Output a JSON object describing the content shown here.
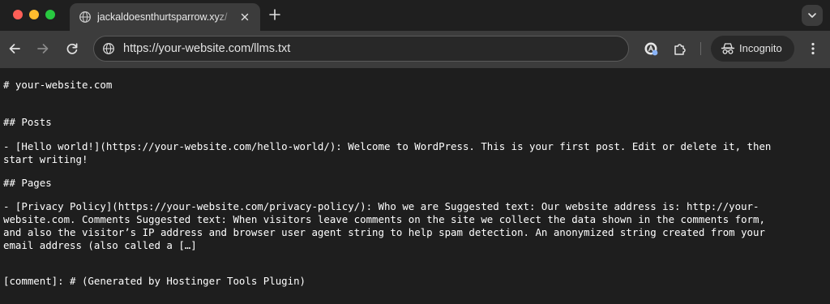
{
  "browser": {
    "tab": {
      "title": "jackaldoesnthurtsparrow.xyz/"
    },
    "address_bar": {
      "url": "https://your-website.com/llms.txt"
    },
    "incognito_label": "Incognito",
    "icons": {
      "favicon": "globe-icon",
      "tab_close": "close-icon",
      "new_tab": "plus-icon",
      "tab_search": "chevron-down-icon",
      "back": "arrow-left-icon",
      "forward": "arrow-right-icon",
      "reload": "reload-icon",
      "site_info": "site-info-icon",
      "extension_1": "extension-badge-icon",
      "extension_2": "puzzle-icon",
      "incognito": "incognito-icon",
      "menu": "kebab-menu-icon"
    },
    "colors": {
      "traffic_close": "#fe5f57",
      "traffic_minimize": "#febc2e",
      "traffic_maximize": "#28c840",
      "toolbar": "#3c3c3c",
      "page_background": "#1e1e1e",
      "text": "#ffffff"
    }
  },
  "document": {
    "lines": [
      "# your-website.com",
      "## Posts",
      "- [Hello world!](https://your-website.com/hello-world/): Welcome to WordPress. This is your first post. Edit or delete it, then",
      "start writing!",
      "## Pages",
      "- [Privacy Policy](https://your-website.com/privacy-policy/): Who we are Suggested text: Our website address is: http://your-",
      "website.com. Comments Suggested text: When visitors leave comments on the site we collect the data shown in the comments form,",
      "and also the visitor’s IP address and browser user agent string to help spam detection. An anonymized string created from your",
      "email address (also called a […]",
      "[comment]: # (Generated by Hostinger Tools Plugin)"
    ]
  }
}
